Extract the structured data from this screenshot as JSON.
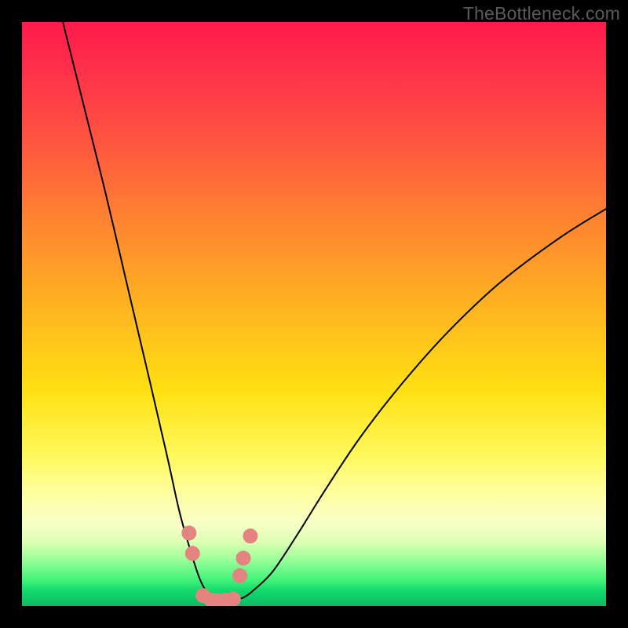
{
  "attribution": "TheBottleneck.com",
  "chart_data": {
    "type": "line",
    "title": "",
    "xlabel": "",
    "ylabel": "",
    "xlim": [
      0,
      100
    ],
    "ylim": [
      0,
      100
    ],
    "grid": false,
    "legend": false,
    "background_gradient": {
      "type": "vertical",
      "stops": [
        {
          "pos": 0.0,
          "color": "#ff1a4b"
        },
        {
          "pos": 0.22,
          "color": "#ff5a3f"
        },
        {
          "pos": 0.49,
          "color": "#ffb420"
        },
        {
          "pos": 0.74,
          "color": "#fff85a"
        },
        {
          "pos": 0.86,
          "color": "#f7ffc6"
        },
        {
          "pos": 0.92,
          "color": "#9cff9b"
        },
        {
          "pos": 1.0,
          "color": "#0fb964"
        }
      ]
    },
    "series": [
      {
        "name": "bottleneck-curve",
        "stroke": "#000000",
        "stroke_width": 2,
        "x": [
          7,
          10,
          14,
          18,
          22,
          25,
          27,
          29,
          30.5,
          32,
          33,
          34.5,
          36,
          38,
          40,
          43,
          47,
          52,
          58,
          65,
          73,
          82,
          92,
          100
        ],
        "y": [
          100,
          88,
          72,
          55,
          38,
          25,
          16,
          9,
          4.5,
          1.8,
          0.9,
          0.7,
          0.9,
          1.5,
          3,
          6,
          12,
          20,
          29,
          38,
          47,
          55.5,
          63,
          68
        ]
      },
      {
        "name": "markers",
        "type": "scatter",
        "stroke": "#e48481",
        "fill": "#e48481",
        "marker_radius": 9,
        "x": [
          28.6,
          29.2,
          31.0,
          32.4,
          33.6,
          34.9,
          36.2,
          37.3,
          37.9,
          39.1
        ],
        "y": [
          12.5,
          9.0,
          1.8,
          1.0,
          0.9,
          1.0,
          1.2,
          5.2,
          8.2,
          12.0
        ]
      }
    ]
  }
}
